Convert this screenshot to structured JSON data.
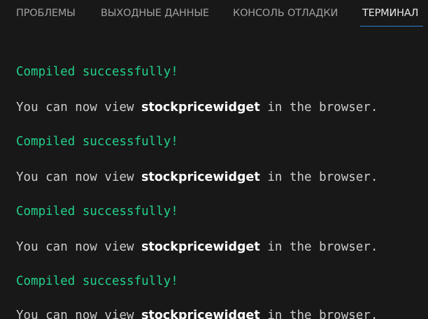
{
  "tabs": [
    {
      "label": "ПРОБЛЕМЫ"
    },
    {
      "label": "ВЫХОДНЫЕ ДАННЫЕ"
    },
    {
      "label": "КОНСОЛЬ ОТЛАДКИ"
    },
    {
      "label": "ТЕРМИНАЛ"
    }
  ],
  "active_tab": "ТЕРМИНАЛ",
  "terminal": {
    "compiled": "Compiled successfully!",
    "view_prefix": "You can now view ",
    "app_name": "stockpricewidget",
    "view_suffix": " in the browser."
  },
  "colors": {
    "success": "#23d18b",
    "active_tab_underline": "#2f7fd0",
    "background": "#181818"
  }
}
